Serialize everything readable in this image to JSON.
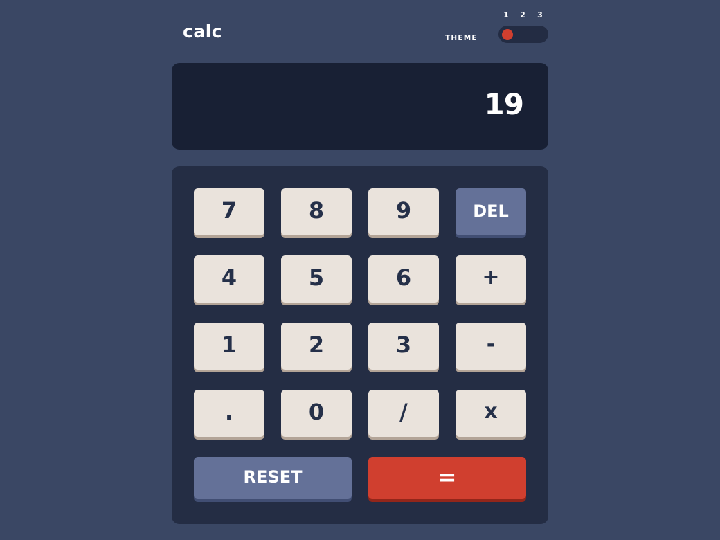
{
  "header": {
    "logo": "calc",
    "theme_label": "THEME",
    "theme_options": [
      "1",
      "2",
      "3"
    ],
    "selected_theme": "1"
  },
  "screen": {
    "value": "19"
  },
  "keypad": {
    "row1": [
      "7",
      "8",
      "9",
      "DEL"
    ],
    "row2": [
      "4",
      "5",
      "6",
      "+"
    ],
    "row3": [
      "1",
      "2",
      "3",
      "-"
    ],
    "row4": [
      ".",
      "0",
      "/",
      "x"
    ],
    "reset": "RESET",
    "equals": "="
  },
  "colors": {
    "background": "#3a4764",
    "screen": "#182034",
    "keypad": "#242d44",
    "key": "#eae3dc",
    "key_shadow": "#b3a497",
    "function_key": "#647198",
    "equals_key": "#d03f2f",
    "toggle_knob": "#d03f2f",
    "text_dark": "#253049",
    "text_light": "#ffffff"
  },
  "icons": {
    "toggle_knob": "circle"
  }
}
